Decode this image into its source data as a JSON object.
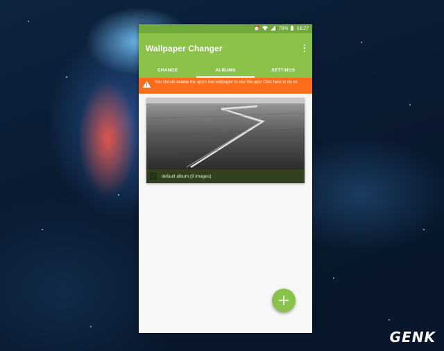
{
  "status_bar": {
    "battery": "78%",
    "time": "18:27",
    "icons": [
      "alarm-icon",
      "wifi-icon",
      "signal-icon",
      "battery-icon"
    ]
  },
  "app_bar": {
    "title": "Wallpaper Changer",
    "menu_icon": "more-vert-icon"
  },
  "tabs": [
    {
      "label": "CHANGE",
      "active": false
    },
    {
      "label": "ALBUMS",
      "active": true
    },
    {
      "label": "SETTINGS",
      "active": false
    }
  ],
  "banner": {
    "icon": "warning-icon",
    "text": "You should enable the app's live wallpaper to use the app! Click here to do so"
  },
  "albums": [
    {
      "label": "default album (9 images)",
      "checked": false
    }
  ],
  "fab": {
    "icon": "add-icon"
  },
  "watermark": "GENK",
  "colors": {
    "primary": "#8bc34a",
    "status_bar": "#6fa93a",
    "banner": "#ff6d1a",
    "album_footer": "#33401f"
  }
}
